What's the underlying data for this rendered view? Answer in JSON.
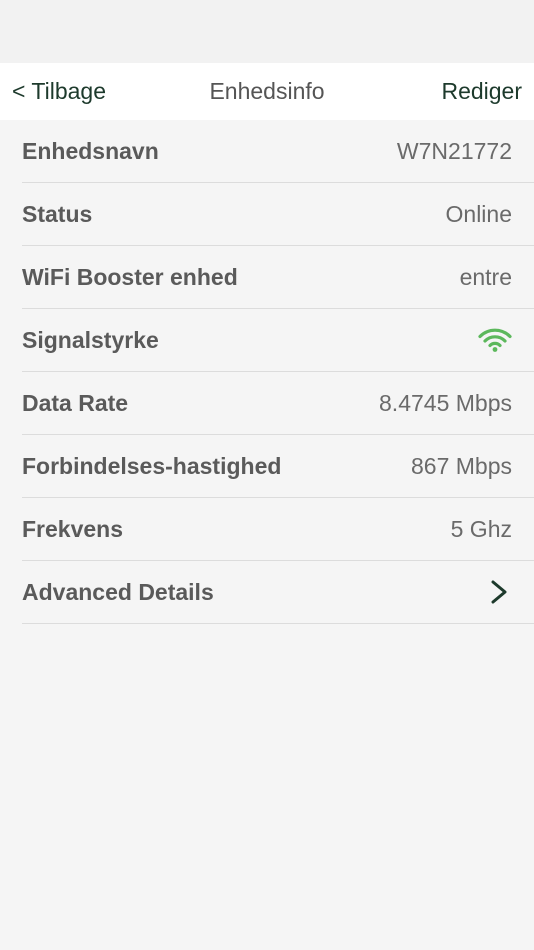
{
  "nav": {
    "back_label": "< Tilbage",
    "title": "Enhedsinfo",
    "edit_label": "Rediger"
  },
  "rows": [
    {
      "label": "Enhedsnavn",
      "value": "W7N21772"
    },
    {
      "label": "Status",
      "value": "Online"
    },
    {
      "label": "WiFi Booster enhed",
      "value": "entre"
    },
    {
      "label": "Signalstyrke",
      "icon": "wifi-signal-icon"
    },
    {
      "label": "Data Rate",
      "value": "8.4745 Mbps"
    },
    {
      "label": "Forbindelses-hastighed",
      "value": "867 Mbps"
    },
    {
      "label": "Frekvens",
      "value": "5 Ghz"
    },
    {
      "label": "Advanced Details",
      "icon": "chevron-right-icon"
    }
  ],
  "colors": {
    "accent": "#1d3a2c",
    "signal": "#5cb85c"
  }
}
